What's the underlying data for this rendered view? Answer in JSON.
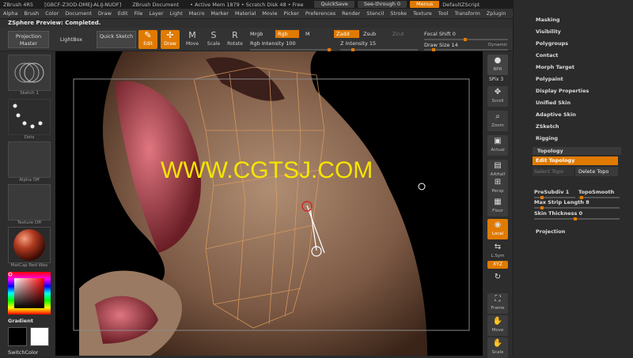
{
  "titlebar": {
    "app": "ZBrush 4R5",
    "license": "[GBCF-Z3OD-DMEJ-ALIJ-NUDF]",
    "doc": "ZBrush Document",
    "mem": "• Active Mem 1879 • Scratch Disk 48 • Free",
    "quicksave": "QuickSave",
    "seethrough": "See-through",
    "seethrough_val": "0",
    "menus": "Menus",
    "script": "DefaultZScript"
  },
  "menu": [
    "Alpha",
    "Brush",
    "Color",
    "Document",
    "Draw",
    "Edit",
    "File",
    "Layer",
    "Light",
    "Macro",
    "Marker",
    "Material",
    "Movie",
    "Picker",
    "Preferences",
    "Render",
    "Stencil",
    "Stroke",
    "Texture",
    "Tool",
    "Transform",
    "Zplugin",
    "Zscript"
  ],
  "status": "ZSphere Preview: Completed.",
  "toolbar": {
    "projection": "Projection Master",
    "lightbox": "LightBox",
    "quicksketch": "Quick Sketch",
    "edit": "Edit",
    "draw": "Draw",
    "move": "Move",
    "scale": "Scale",
    "rotate": "Rotate",
    "mrgb": "Mrgb",
    "rgb": "Rgb",
    "m": "M",
    "zadd": "Zadd",
    "zsub": "Zsub",
    "zcut": "Zcut",
    "rgb_int": "Rgb Intensity",
    "rgb_int_val": "100",
    "z_int": "Z Intensity",
    "z_int_val": "15",
    "focal": "Focal Shift",
    "focal_val": "0",
    "drawsize": "Draw Size",
    "drawsize_val": "14",
    "dynamic": "Dynamic"
  },
  "left": {
    "sketch": "Sketch 1",
    "dots": "Dots",
    "alpha": "Alpha Off",
    "texture": "Texture Off",
    "matcap": "MatCap Red Wax",
    "gradient": "Gradient",
    "switchcolor": "SwitchColor"
  },
  "right": {
    "bpr": "BPR",
    "spix": "SPix 3",
    "scroll": "Scroll",
    "zoom": "Zoom",
    "actual": "Actual",
    "aahalf": "AAHalf",
    "persp": "Persp",
    "floor": "Floor",
    "local": "Local",
    "lsym": "L.Sym",
    "xyz": "XYZ",
    "frame": "Frame",
    "move": "Move",
    "scale": "Scale"
  },
  "panel": {
    "items": [
      "Masking",
      "Visibility",
      "Polygroups",
      "Contact",
      "Morph Target",
      "Polypaint",
      "Display Properties",
      "Unified Skin",
      "Adaptive Skin",
      "ZSketch",
      "Rigging"
    ],
    "topology": "Topology",
    "edit_topology": "Edit Topology",
    "select_topo": "Select Topo",
    "delete_topo": "Delete Topo",
    "presubdiv": "PreSubdiv",
    "presubdiv_val": "1",
    "toposmooth": "TopoSmooth",
    "maxstrip": "Max Strip Length",
    "maxstrip_val": "8",
    "skinthick": "Skin Thickness",
    "skinthick_val": "0",
    "projection": "Projection"
  },
  "watermark": "WWW.CGTSJ.COM",
  "colors": {
    "accent": "#e07a00",
    "watermark": "#f5e500"
  }
}
